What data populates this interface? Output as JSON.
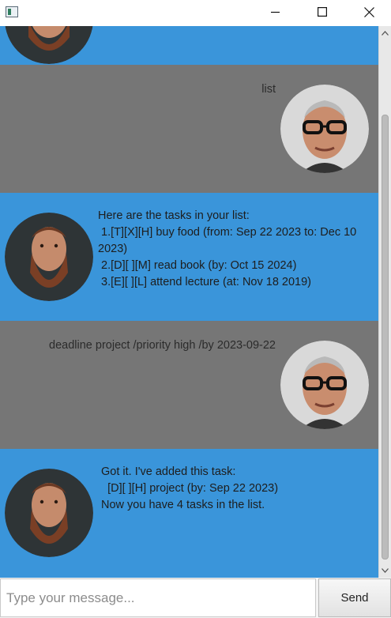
{
  "window": {
    "title": "",
    "controls": [
      "minimize-icon",
      "maximize-icon",
      "close-icon"
    ]
  },
  "colors": {
    "user_bg": "#767676",
    "bot_bg": "#3a95da",
    "scrollbar_track": "#e8e8e8",
    "scrollbar_thumb": "#bcbcbc"
  },
  "messages": [
    {
      "sender": "bot",
      "avatar": "bearded-man-avatar",
      "text": ""
    },
    {
      "sender": "user",
      "avatar": "glasses-man-avatar",
      "text": "list"
    },
    {
      "sender": "bot",
      "avatar": "bearded-man-avatar",
      "text": "Here are the tasks in your list:\n 1.[T][X][H] buy food (from: Sep 22 2023 to: Dec 10\n2023)\n 2.[D][ ][M] read book (by: Oct 15 2024)\n 3.[E][ ][L] attend lecture (at: Nov 18 2019)"
    },
    {
      "sender": "user",
      "avatar": "glasses-man-avatar",
      "text": "deadline project /priority high /by 2023-09-22"
    },
    {
      "sender": "bot",
      "avatar": "bearded-man-avatar",
      "text": "Got it. I've added this task:\n  [D][ ][H] project (by: Sep 22 2023)\nNow you have 4 tasks in the list."
    }
  ],
  "input": {
    "placeholder": "Type your message...",
    "value": ""
  },
  "send_button": {
    "label": "Send"
  }
}
